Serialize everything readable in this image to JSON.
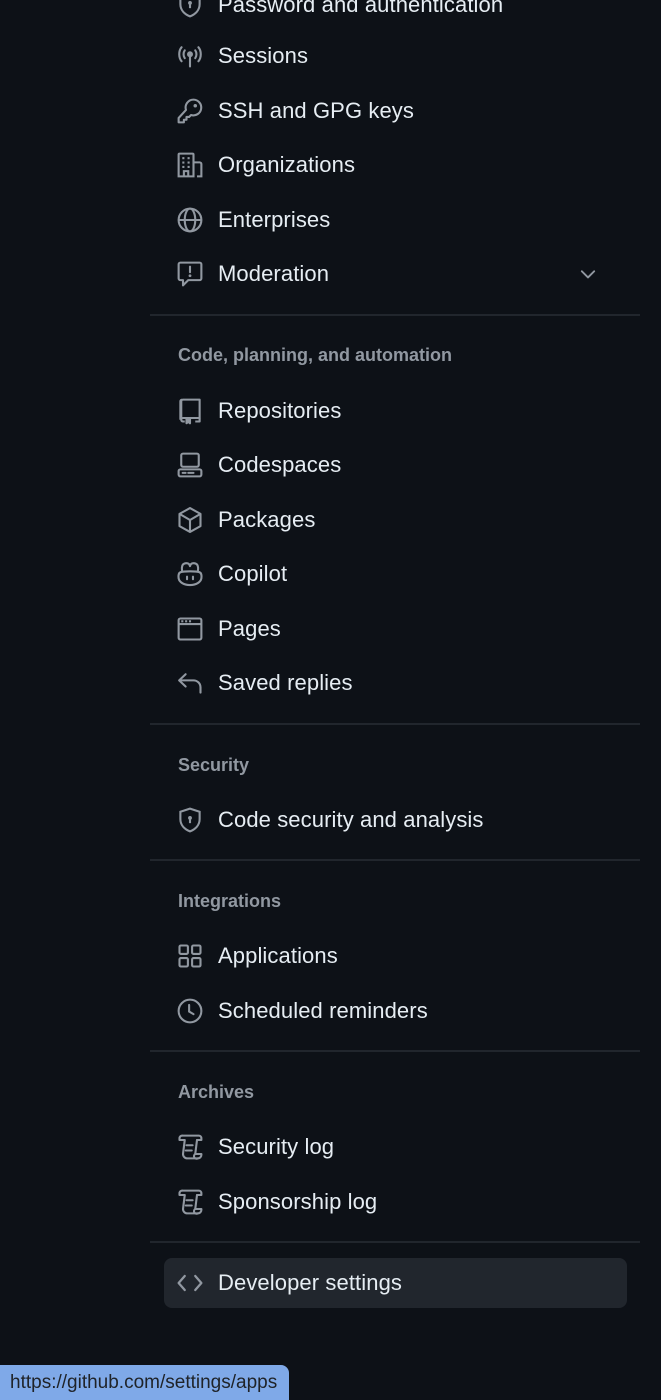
{
  "sections": [
    {
      "heading": null,
      "items": [
        {
          "label": "Password and authentication",
          "icon": "shield-lock-icon"
        },
        {
          "label": "Sessions",
          "icon": "broadcast-icon"
        },
        {
          "label": "SSH and GPG keys",
          "icon": "key-icon"
        },
        {
          "label": "Organizations",
          "icon": "organization-icon"
        },
        {
          "label": "Enterprises",
          "icon": "globe-icon"
        },
        {
          "label": "Moderation",
          "icon": "report-icon",
          "expandable": true
        }
      ]
    },
    {
      "heading": "Code, planning, and automation",
      "items": [
        {
          "label": "Repositories",
          "icon": "repo-icon"
        },
        {
          "label": "Codespaces",
          "icon": "codespaces-icon"
        },
        {
          "label": "Packages",
          "icon": "package-icon"
        },
        {
          "label": "Copilot",
          "icon": "copilot-icon"
        },
        {
          "label": "Pages",
          "icon": "browser-icon"
        },
        {
          "label": "Saved replies",
          "icon": "reply-icon"
        }
      ]
    },
    {
      "heading": "Security",
      "items": [
        {
          "label": "Code security and analysis",
          "icon": "shield-lock-icon"
        }
      ]
    },
    {
      "heading": "Integrations",
      "items": [
        {
          "label": "Applications",
          "icon": "apps-icon"
        },
        {
          "label": "Scheduled reminders",
          "icon": "clock-icon"
        }
      ]
    },
    {
      "heading": "Archives",
      "items": [
        {
          "label": "Security log",
          "icon": "log-icon"
        },
        {
          "label": "Sponsorship log",
          "icon": "log-icon"
        }
      ]
    }
  ],
  "developer_settings": {
    "label": "Developer settings",
    "icon": "code-icon",
    "active": true
  },
  "status_bar": {
    "url": "https://github.com/settings/apps"
  },
  "colors": {
    "background": "#0d1117",
    "text": "#e6edf3",
    "muted": "#9198a1",
    "active_bg": "#21262d",
    "status_bg": "#7fa9e8"
  }
}
